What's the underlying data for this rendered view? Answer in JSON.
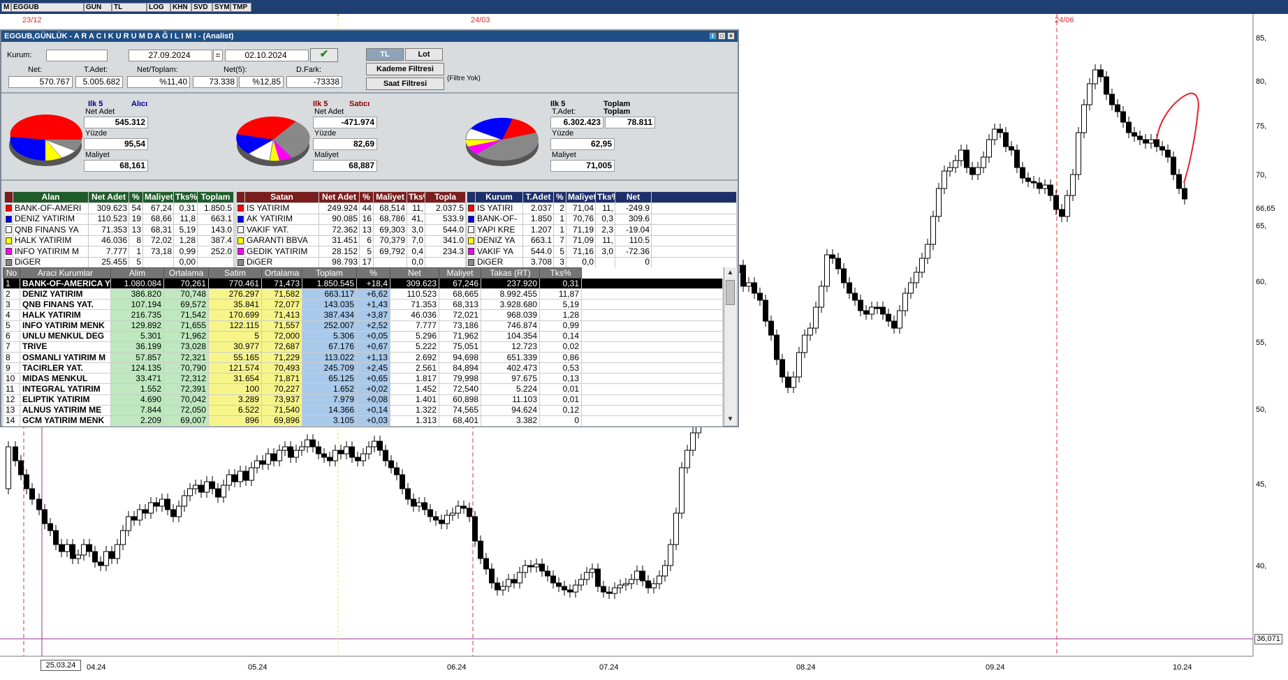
{
  "toolbar": {
    "items": [
      "M",
      "EGGUB",
      "GUN",
      "TL",
      "LOG",
      "KHN",
      "SVD",
      "SYM",
      "TMP"
    ]
  },
  "chart": {
    "top_dates": [
      "23/12",
      "24/03",
      "24/06"
    ],
    "y_ticks": [
      "85,",
      "80,",
      "75,",
      "70,",
      "66,65",
      "65,",
      "60,",
      "55,",
      "50,",
      "45,",
      "40,"
    ],
    "last_price": "36,071",
    "x_ticks": [
      "25.03.24",
      "04.24",
      "05.24",
      "06.24",
      "07.24",
      "08.24",
      "09.24",
      "10.24"
    ],
    "colors": {
      "up": "#ffffff",
      "down": "#000000",
      "event_line": "#e03131",
      "cursor_line": "#9b2f9b",
      "hline": "#9b2f9b"
    }
  },
  "window": {
    "title": "EGGUB,GÜNLÜK  -  A R A C I   K U R U M   D A Ğ I L I M I  - (Analist)",
    "kurum_label": "Kurum:",
    "kurum_value": "",
    "date_from": "27.09.2024",
    "eq": "=",
    "date_to": "02.10.2024",
    "tl_btn": "TL",
    "lot_btn": "Lot",
    "kademe_btn": "Kademe Filtresi",
    "saat_btn": "Saat Filtresi",
    "filter_note": "(Filtre Yok)",
    "summary": [
      {
        "label": "Net:",
        "value": "570.767"
      },
      {
        "label": "T.Adet:",
        "value": "5.005.682"
      },
      {
        "label": "Net/Toplam:",
        "value": "%11,40"
      },
      {
        "label": "Net(5):",
        "value": "73.338"
      },
      {
        "label": "",
        "value": "%12,85"
      },
      {
        "label": "D.Fark:",
        "value": "-73338"
      }
    ]
  },
  "pies": [
    {
      "title": "Ilk 5",
      "subtitle": "Alıcı",
      "labels": [
        "Net Adet",
        "Yüzde",
        "Maliyet"
      ],
      "values": [
        "545.312",
        "95,54",
        "68,161"
      ]
    },
    {
      "title": "Ilk 5",
      "subtitle": "Satıcı",
      "labels": [
        "Net Adet",
        "Yüzde",
        "Maliyet"
      ],
      "values": [
        "-471.974",
        "82,69",
        "68,887"
      ]
    },
    {
      "title": "Ilk 5",
      "subtitle": "Toplam",
      "labels": [
        "T.Adet:",
        "Yüzde",
        "Maliyet"
      ],
      "values": [
        "6.302.423",
        "62,95",
        "71,005"
      ],
      "extra_label": "Toplam",
      "extra_value": "78.811"
    }
  ],
  "alan": {
    "headers": [
      "Alan",
      "Net Adet",
      "%",
      "Maliyet",
      "Tks%",
      "Toplam"
    ],
    "rows": [
      {
        "c": "#ff0000",
        "v": [
          "BANK-OF-AMERI",
          "309.623",
          "54",
          "67,24",
          "0,31",
          "1.850.5"
        ]
      },
      {
        "c": "#0000ff",
        "v": [
          "DENIZ YATIRIM",
          "110.523",
          "19",
          "68,66",
          "11,8",
          "663.1"
        ]
      },
      {
        "c": "#ffffff",
        "v": [
          "QNB FINANS YA",
          "71.353",
          "13",
          "68,31",
          "5,19",
          "143.0"
        ]
      },
      {
        "c": "#ffff00",
        "v": [
          "HALK YATIRIM",
          "46.036",
          "8",
          "72,02",
          "1,28",
          "387.4"
        ]
      },
      {
        "c": "#ff00ff",
        "v": [
          "INFO YATIRIM M",
          "7.777",
          "1",
          "73,18",
          "0,99",
          "252.0"
        ]
      },
      {
        "c": "#888888",
        "v": [
          "DiGER",
          "25.455",
          "5",
          "",
          "0,00",
          ""
        ]
      }
    ]
  },
  "satan": {
    "headers": [
      "Satan",
      "Net Adet",
      "%",
      "Maliyet",
      "Tks%",
      "Topla"
    ],
    "rows": [
      {
        "c": "#ff0000",
        "v": [
          "IS YATIRIM",
          "249.924",
          "44",
          "68,514",
          "11,",
          "2.037.5"
        ]
      },
      {
        "c": "#0000ff",
        "v": [
          "AK YATIRIM",
          "90.085",
          "16",
          "68,786",
          "41,",
          "533.9"
        ]
      },
      {
        "c": "#ffffff",
        "v": [
          "VAKIF YAT.",
          "72.362",
          "13",
          "69,303",
          "3,0",
          "544.0"
        ]
      },
      {
        "c": "#ffff00",
        "v": [
          "GARANTI BBVA",
          "31.451",
          "6",
          "70,379",
          "7,0",
          "341.0"
        ]
      },
      {
        "c": "#ff00ff",
        "v": [
          "GEDIK YATIRIM",
          "28.152",
          "5",
          "69,792",
          "0,4",
          "234.3"
        ]
      },
      {
        "c": "#888888",
        "v": [
          "DiGER",
          "98.793",
          "17",
          "",
          "0,0",
          ""
        ]
      }
    ]
  },
  "toplam": {
    "headers": [
      "Kurum",
      "T.Adet",
      "%",
      "Maliyet",
      "Tks%",
      "Net"
    ],
    "rows": [
      {
        "c": "#ff0000",
        "v": [
          "IS YATIRI",
          "2.037",
          "2",
          "71,04",
          "11,",
          "-249.9"
        ]
      },
      {
        "c": "#0000ff",
        "v": [
          "BANK-OF-",
          "1.850",
          "1",
          "70,76",
          "0,3",
          "309.6"
        ]
      },
      {
        "c": "#ffffff",
        "v": [
          "YAPI KRE",
          "1.207",
          "1",
          "71,19",
          "2,3",
          "-19.04"
        ]
      },
      {
        "c": "#ffff00",
        "v": [
          "DENIZ YA",
          "663.1",
          "7",
          "71,09",
          "11,",
          "110.5"
        ]
      },
      {
        "c": "#ff00ff",
        "v": [
          "VAKIF YA",
          "544.0",
          "5",
          "71,16",
          "3,0",
          "-72.36"
        ]
      },
      {
        "c": "#888888",
        "v": [
          "DiGER",
          "3.708",
          "3",
          "0,0",
          "",
          "0"
        ]
      }
    ]
  },
  "main_table": {
    "headers": [
      "No",
      "Araci Kurumlar",
      "Alim",
      "Ortalama",
      "Satim",
      "Ortalama",
      "Toplam",
      "%",
      "Net",
      "Maliyet",
      "Takas (RT)",
      "Tks%"
    ],
    "rows": [
      [
        "1",
        "BANK-OF-AMERICA Y",
        "1.080.084",
        "70,261",
        "770.461",
        "71,473",
        "1.850.545",
        "+18,4",
        "309.623",
        "67,246",
        "237.920",
        "0,31"
      ],
      [
        "2",
        "DENIZ YATIRIM",
        "386.820",
        "70,748",
        "276.297",
        "71,582",
        "663.117",
        "+6,62",
        "110.523",
        "68,665",
        "8.992.455",
        "11,87"
      ],
      [
        "3",
        "QNB FINANS YAT.",
        "107.194",
        "69,572",
        "35.841",
        "72,077",
        "143.035",
        "+1,43",
        "71.353",
        "68,313",
        "3.928.680",
        "5,19"
      ],
      [
        "4",
        "HALK YATIRIM",
        "216.735",
        "71,542",
        "170.699",
        "71,413",
        "387.434",
        "+3,87",
        "46.036",
        "72,021",
        "968.039",
        "1,28"
      ],
      [
        "5",
        "INFO YATIRIM MENK",
        "129.892",
        "71,655",
        "122.115",
        "71,557",
        "252.007",
        "+2,52",
        "7.777",
        "73,186",
        "746.874",
        "0,99"
      ],
      [
        "6",
        "UNLU MENKUL DEG",
        "5.301",
        "71,962",
        "5",
        "72,000",
        "5.306",
        "+0,05",
        "5.296",
        "71,962",
        "104.354",
        "0,14"
      ],
      [
        "7",
        "TRIVE",
        "36.199",
        "73,028",
        "30.977",
        "72,687",
        "67.176",
        "+0,67",
        "5.222",
        "75,051",
        "12.723",
        "0,02"
      ],
      [
        "8",
        "OSMANLI YATIRIM M",
        "57.857",
        "72,321",
        "55.165",
        "71,229",
        "113.022",
        "+1,13",
        "2.692",
        "94,698",
        "651.339",
        "0,86"
      ],
      [
        "9",
        "TACIRLER YAT.",
        "124.135",
        "70,790",
        "121.574",
        "70,493",
        "245.709",
        "+2,45",
        "2.561",
        "84,894",
        "402.473",
        "0,53"
      ],
      [
        "10",
        "MIDAS MENKUL",
        "33.471",
        "72,312",
        "31.654",
        "71,871",
        "65.125",
        "+0,65",
        "1.817",
        "79,998",
        "97.675",
        "0,13"
      ],
      [
        "11",
        "INTEGRAL YATIRIM",
        "1.552",
        "72,391",
        "100",
        "70,227",
        "1.652",
        "+0,02",
        "1.452",
        "72,540",
        "5.224",
        "0,01"
      ],
      [
        "12",
        "ELIPTIK YATIRIM",
        "4.690",
        "70,042",
        "3.289",
        "73,937",
        "7.979",
        "+0,08",
        "1.401",
        "60,898",
        "11.103",
        "0,01"
      ],
      [
        "13",
        "ALNUS YATIRIM ME",
        "7.844",
        "72,050",
        "6.522",
        "71,540",
        "14.366",
        "+0,14",
        "1.322",
        "74,565",
        "94.624",
        "0,12"
      ],
      [
        "14",
        "GCM YATIRIM MENK",
        "2.209",
        "69,007",
        "896",
        "69,896",
        "3.105",
        "+0,03",
        "1.313",
        "68,401",
        "3.382",
        "0"
      ]
    ]
  }
}
